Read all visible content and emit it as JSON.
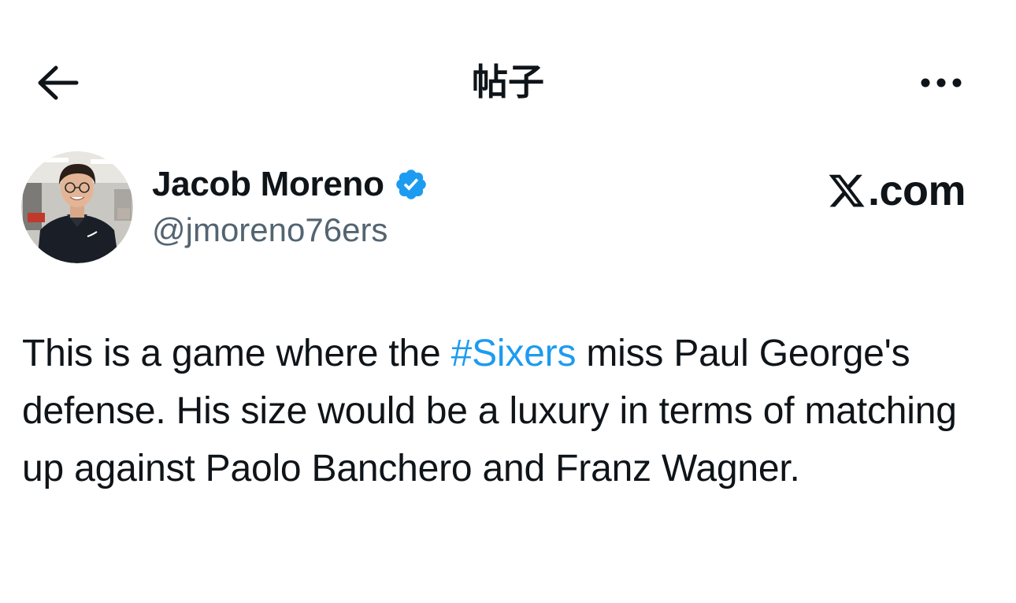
{
  "header": {
    "title": "帖子",
    "back_icon": "arrow-left-icon",
    "more_icon": "more-horizontal-icon"
  },
  "author": {
    "display_name": "Jacob Moreno",
    "handle": "@jmoreno76ers",
    "verified": true,
    "verified_icon": "verified-badge-icon",
    "verified_color": "#1d9bf0"
  },
  "watermark": {
    "logo_icon": "x-logo-icon",
    "text": ".com"
  },
  "tweet": {
    "text_before": "This is a game where the ",
    "hashtag": "#Sixers",
    "text_after": " miss Paul George's defense. His size would be a luxury in terms of matching up against Paolo Banchero and Franz Wagner."
  },
  "colors": {
    "text_primary": "#0f1419",
    "text_secondary": "#536471",
    "accent": "#1d9bf0",
    "background": "#ffffff"
  }
}
